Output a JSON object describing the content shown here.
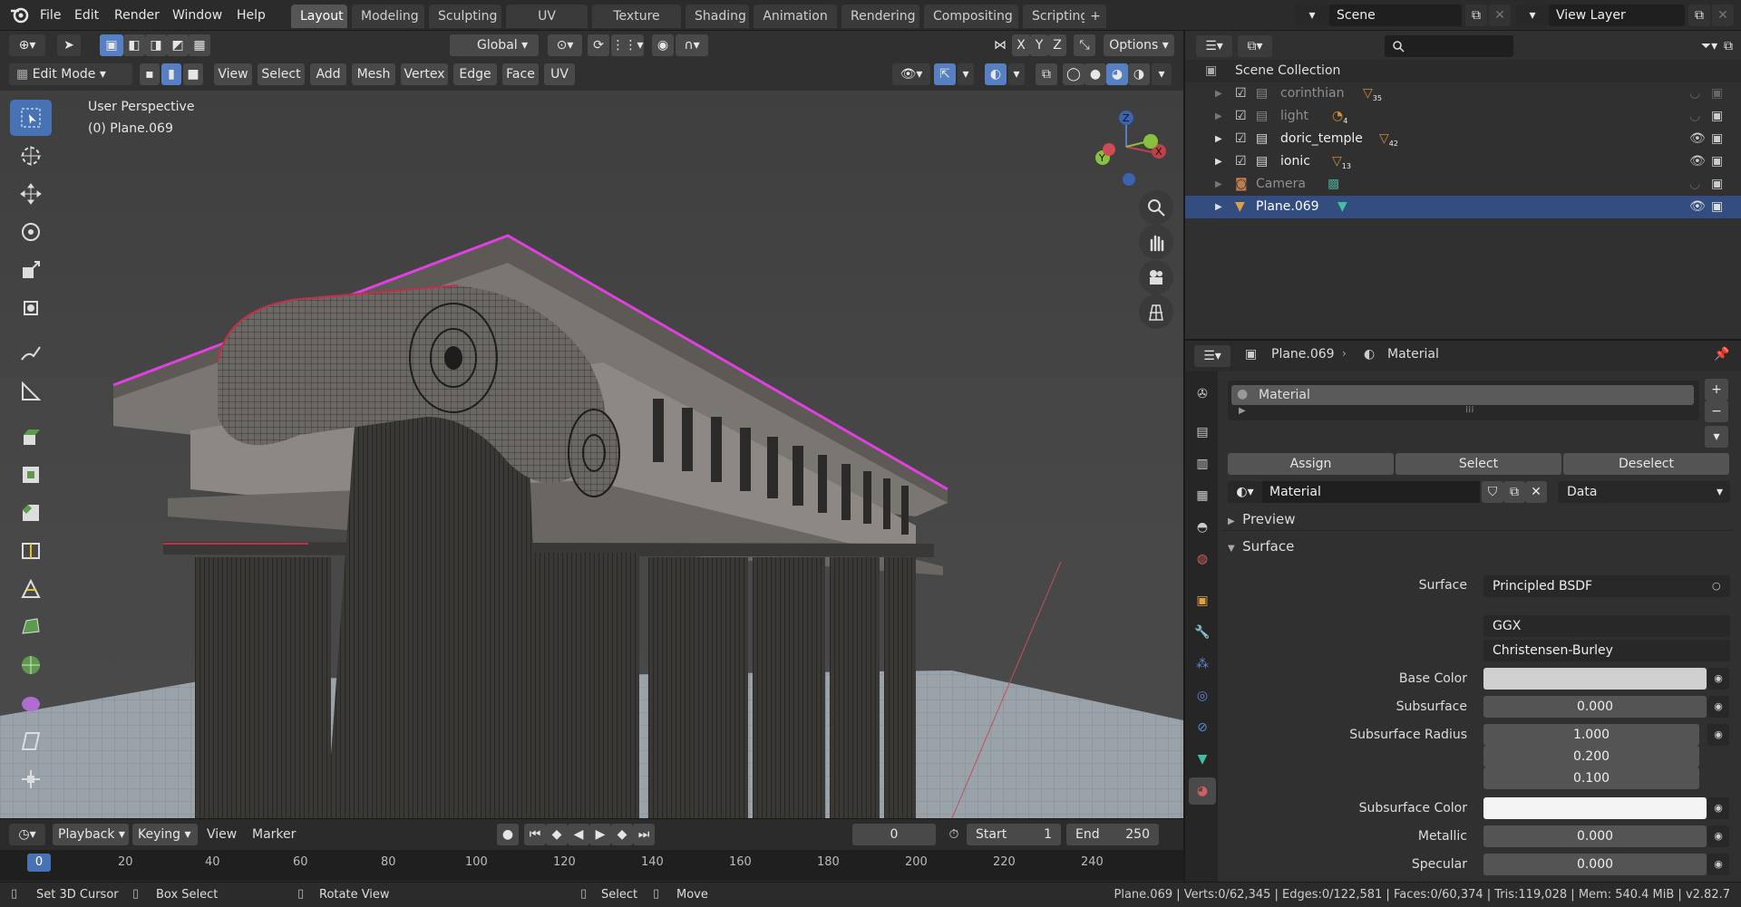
{
  "menu": {
    "file": "File",
    "edit": "Edit",
    "render": "Render",
    "window": "Window",
    "help": "Help"
  },
  "workspaces": [
    "Layout",
    "Modeling",
    "Sculpting",
    "UV Editing",
    "Texture Paint",
    "Shading",
    "Animation",
    "Rendering",
    "Compositing",
    "Scripting"
  ],
  "active_workspace": "Layout",
  "scene": {
    "label": "Scene"
  },
  "view_layer": {
    "label": "View Layer"
  },
  "viewport_header": {
    "orientation": "Global",
    "axes": [
      "X",
      "Y",
      "Z"
    ],
    "options": "Options",
    "mode": "Edit Mode",
    "menus": [
      "View",
      "Select",
      "Add",
      "Mesh",
      "Vertex",
      "Edge",
      "Face",
      "UV"
    ]
  },
  "overlay": {
    "perspective": "User Perspective",
    "object": "(0) Plane.069"
  },
  "gizmo": {
    "z": "Z",
    "y": "Y",
    "x": "X"
  },
  "timeline": {
    "menus": [
      "Playback",
      "Keying",
      "View",
      "Marker"
    ],
    "current_frame": "0",
    "start_label": "Start",
    "start": "1",
    "end_label": "End",
    "end": "250",
    "ticks": [
      "0",
      "20",
      "40",
      "60",
      "80",
      "100",
      "120",
      "140",
      "160",
      "180",
      "200",
      "220",
      "240"
    ]
  },
  "status": {
    "set_cursor": "Set 3D Cursor",
    "box_select": "Box Select",
    "rotate_view": "Rotate View",
    "select": "Select",
    "move": "Move",
    "stats": "Plane.069 | Verts:0/62,345 | Edges:0/122,581 | Faces:0/60,374 | Tris:119,028 | Mem: 540.4 MiB | v2.82.7"
  },
  "outliner": {
    "root": "Scene Collection",
    "items": [
      {
        "name": "corinthian",
        "badge": "35",
        "dim": true
      },
      {
        "name": "light",
        "badge": "4",
        "dim": true
      },
      {
        "name": "doric_temple",
        "badge": "42",
        "dim": false
      },
      {
        "name": "ionic",
        "badge": "13",
        "dim": false
      },
      {
        "name": "Camera",
        "badge": "",
        "dim": true
      },
      {
        "name": "Plane.069",
        "badge": "",
        "dim": false
      }
    ]
  },
  "properties": {
    "breadcrumb_object": "Plane.069",
    "breadcrumb_material": "Material",
    "slot_name": "Material",
    "assign": "Assign",
    "select": "Select",
    "deselect": "Deselect",
    "material_name": "Material",
    "link": "Data",
    "preview": "Preview",
    "surface_panel": "Surface",
    "surface_label": "Surface",
    "surface_value": "Principled BSDF",
    "distribution": "GGX",
    "subsurface_method": "Christensen-Burley",
    "base_color_label": "Base Color",
    "subsurface_label": "Subsurface",
    "subsurface_value": "0.000",
    "subsurface_radius_label": "Subsurface Radius",
    "radius": [
      "1.000",
      "0.200",
      "0.100"
    ],
    "subsurface_color_label": "Subsurface Color",
    "metallic_label": "Metallic",
    "metallic_value": "0.000",
    "specular_label": "Specular",
    "specular_value": "0.000"
  },
  "colors": {
    "accent": "#4772b3",
    "outliner_selected": "#334d80",
    "seam": "#c0304a",
    "edge_crease": "#e040e0"
  }
}
